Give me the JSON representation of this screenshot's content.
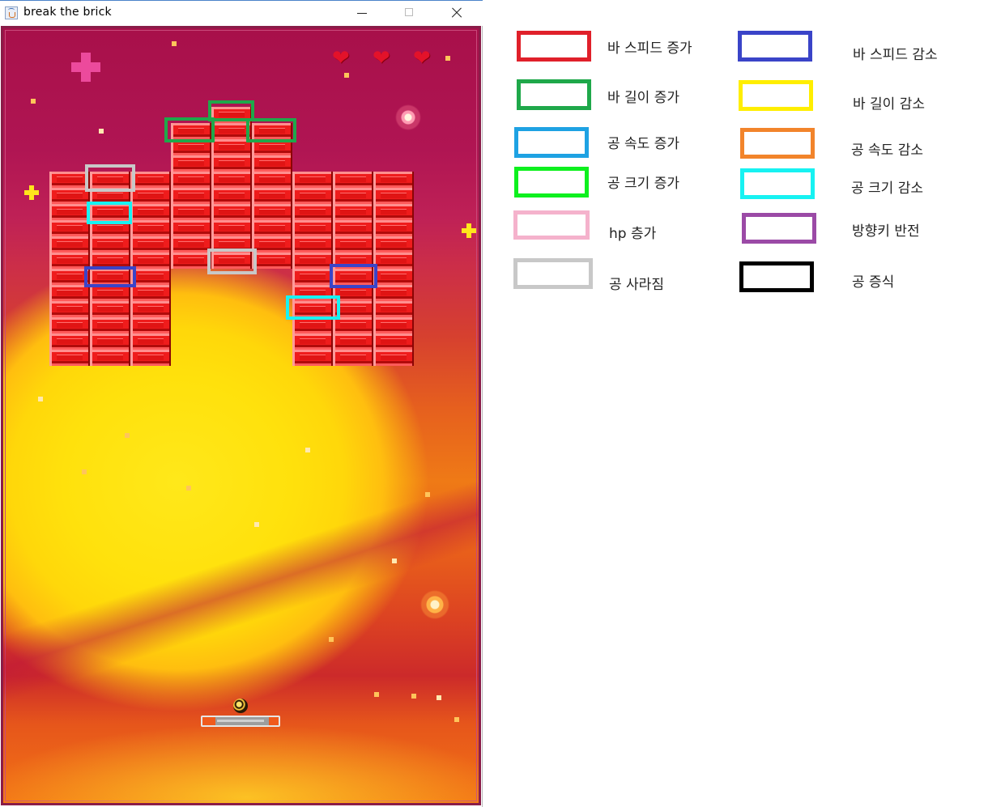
{
  "window": {
    "title": "break the brick",
    "controls": [
      "minimize-icon",
      "maximize-icon",
      "close-icon"
    ]
  },
  "game": {
    "hp": 3,
    "heart_icon": "heart-icon",
    "heart_glyph": "❤",
    "brick_color": "#ef1c1c",
    "paddle_icon": "paddle",
    "ball_icon": "ball"
  },
  "legend": {
    "items": [
      {
        "label": "바 스피드 증가",
        "color": "#e0202a"
      },
      {
        "label": "바 스피드 감소",
        "color": "#3a44c8"
      },
      {
        "label": "바 길이 증가",
        "color": "#1fa84a"
      },
      {
        "label": "바 길이 감소",
        "color": "#ffee00"
      },
      {
        "label": "공 속도 증가",
        "color": "#1ea2e3"
      },
      {
        "label": "공 속도 감소",
        "color": "#f2842b"
      },
      {
        "label": "공 크기 증가",
        "color": "#0ef01e"
      },
      {
        "label": "공 크기 감소",
        "color": "#17f2f2"
      },
      {
        "label": "hp 층가",
        "color": "#f5b2cc"
      },
      {
        "label": "방향키 반전",
        "color": "#9b4aa6"
      },
      {
        "label": "공 사라짐",
        "color": "#c8c8c8"
      },
      {
        "label": "공 증식",
        "color": "#000000"
      }
    ]
  }
}
